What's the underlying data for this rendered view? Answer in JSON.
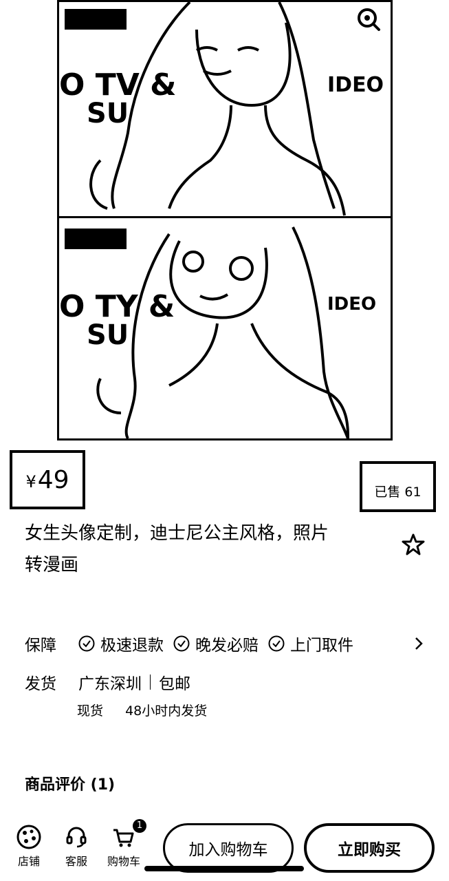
{
  "product": {
    "price_symbol": "¥",
    "price": "49",
    "sold": "已售 61",
    "title_line1": "女生头像定制，迪士尼公主风格，照片",
    "title_line2": "转漫画"
  },
  "guarantee": {
    "label": "保障",
    "items": [
      "极速退款",
      "晚发必赔",
      "上门取件"
    ]
  },
  "shipping": {
    "label": "发货",
    "location": "广东深圳",
    "free_shipping": "包邮",
    "stock": "现货",
    "dispatch": "48小时内发货"
  },
  "reviews": {
    "label": "商品评价 (1)"
  },
  "bottom_bar": {
    "store": "店铺",
    "service": "客服",
    "cart": "购物车",
    "cart_count": "1",
    "add_to_cart": "加入购物车",
    "buy_now": "立即购买"
  },
  "icons": [
    "zoom-icon",
    "star-icon",
    "check-circle-icon",
    "chevron-right-icon",
    "store-icon",
    "headset-icon",
    "cart-icon"
  ]
}
